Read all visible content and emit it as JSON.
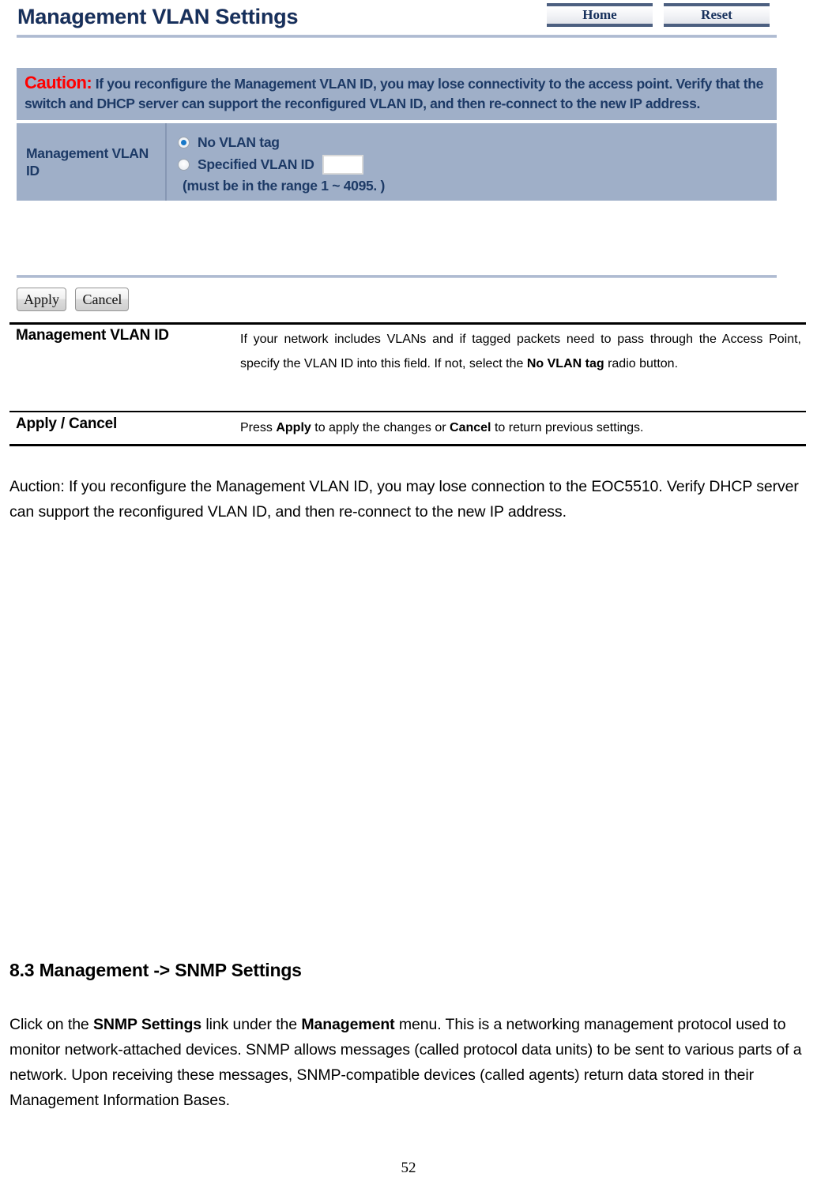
{
  "document": {
    "page_number": "52"
  },
  "ui_screenshot": {
    "title": "Management VLAN Settings",
    "header_buttons": {
      "home": "Home",
      "reset": "Reset"
    },
    "caution": {
      "label": "Caution:",
      "text": "If you reconfigure the Management VLAN ID, you may lose connectivity to the access point. Verify that the switch and DHCP server can support the reconfigured VLAN ID, and then re-connect to the new IP address."
    },
    "vlan_row": {
      "label": "Management VLAN ID",
      "radio_no_tag": {
        "label": "No VLAN tag",
        "selected": true
      },
      "radio_specified": {
        "label": "Specified VLAN ID",
        "selected": false,
        "input_value": "",
        "input_placeholder": ""
      },
      "range_note": "(must be in the range 1 ~ 4095. )"
    },
    "form_buttons": {
      "apply": "Apply",
      "cancel": "Cancel"
    }
  },
  "description_table": {
    "rows": [
      {
        "key": "Management VLAN ID",
        "value_parts": [
          {
            "text": "If your network includes VLANs and if tagged packets need to pass through the Access Point, specify the VLAN ID into this field. If not, select the ",
            "bold": false
          },
          {
            "text": "No VLAN tag",
            "bold": true
          },
          {
            "text": " radio button.",
            "bold": false
          }
        ]
      },
      {
        "key": "Apply / Cancel",
        "value_parts": [
          {
            "text": "Press ",
            "bold": false
          },
          {
            "text": "Apply",
            "bold": true
          },
          {
            "text": " to apply the changes or ",
            "bold": false
          },
          {
            "text": "Cancel",
            "bold": true
          },
          {
            "text": " to return previous settings.",
            "bold": false
          }
        ]
      }
    ]
  },
  "auction_note": "Auction: If you reconfigure the Management VLAN ID, you may lose connection to the EOC5510. Verify DHCP server can support the reconfigured VLAN ID, and then re-connect to the new IP address.",
  "snmp_section": {
    "heading": "8.3 Management -> SNMP Settings",
    "body_parts": [
      {
        "text": "Click on the ",
        "bold": false
      },
      {
        "text": "SNMP Settings",
        "bold": true
      },
      {
        "text": " link under the ",
        "bold": false
      },
      {
        "text": "Management",
        "bold": true
      },
      {
        "text": " menu. This is a networking management protocol used to monitor network-attached devices. SNMP allows messages (called protocol data units) to be sent to various parts of a network. Upon receiving these messages, SNMP-compatible devices (called agents) return data stored in their Management Information Bases.",
        "bold": false
      }
    ]
  },
  "colors": {
    "panel_background": "#9fafc8",
    "title_navy": "#16305c",
    "caution_red": "#ff0000",
    "rule_blue": "#a9b6cd",
    "radio_dot_blue": "#1878c8"
  }
}
